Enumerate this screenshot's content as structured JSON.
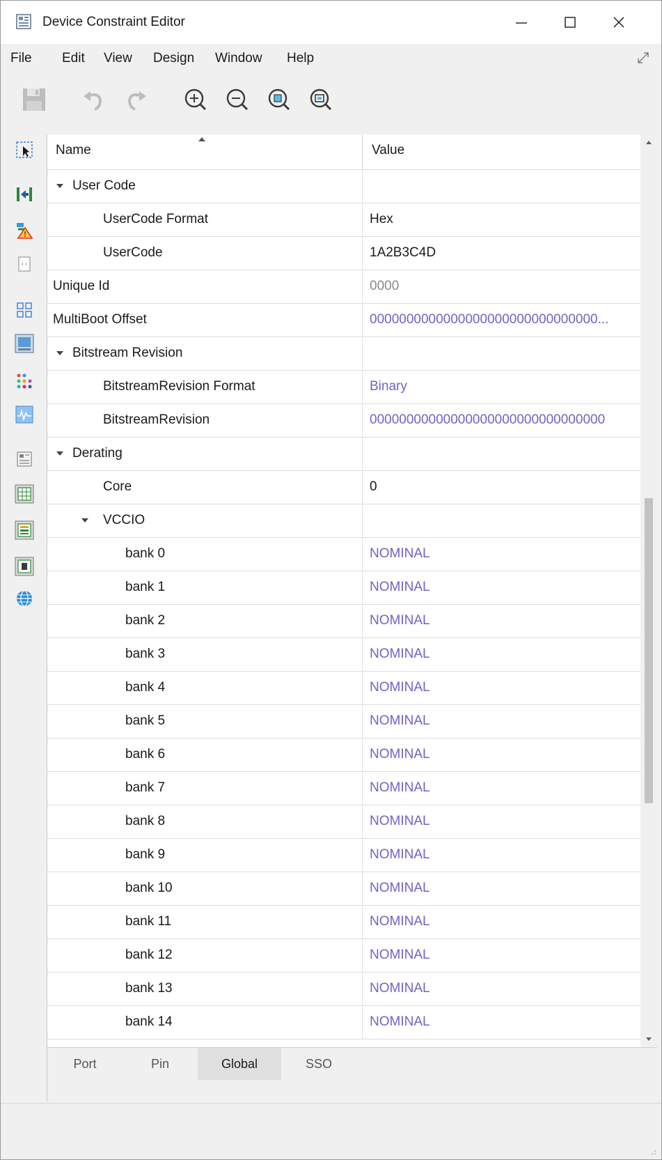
{
  "window": {
    "title": "Device Constraint Editor",
    "minimize_label": "minimize",
    "maximize_label": "maximize",
    "close_label": "close"
  },
  "menu": [
    {
      "label": "File"
    },
    {
      "label": "Edit"
    },
    {
      "label": "View"
    },
    {
      "label": "Design"
    },
    {
      "label": "Window"
    },
    {
      "label": "Help"
    }
  ],
  "toolbar": {
    "icons": [
      "save-icon",
      "undo-icon",
      "redo-icon",
      "zoom-in-icon",
      "zoom-out-icon",
      "zoom-fit-icon",
      "zoom-selection-icon"
    ]
  },
  "sidebar": {
    "icons": [
      "select-icon",
      "assign-icon",
      "drc-warning-icon",
      "pin-view-icon",
      "layout-grid-icon",
      "chip-view-icon",
      "color-dots-icon",
      "waveform-icon",
      "package-icon",
      "spreadsheet-icon",
      "list-view-icon",
      "device-icon",
      "globe-icon"
    ]
  },
  "grid": {
    "columns": {
      "name": "Name",
      "value": "Value"
    },
    "rows": [
      {
        "name": "User Code",
        "value": "",
        "level": 0,
        "expandable": true,
        "style": "dark"
      },
      {
        "name": "UserCode Format",
        "value": "Hex",
        "level": 1,
        "expandable": false,
        "style": "dark"
      },
      {
        "name": "UserCode",
        "value": "1A2B3C4D",
        "level": 1,
        "expandable": false,
        "style": "dark"
      },
      {
        "name": "Unique Id",
        "value": "0000",
        "level": -1,
        "expandable": false,
        "style": "gray"
      },
      {
        "name": "MultiBoot Offset",
        "value": "0000000000000000000000000000000...",
        "level": -1,
        "expandable": false,
        "style": "blue"
      },
      {
        "name": "Bitstream Revision",
        "value": "",
        "level": 0,
        "expandable": true,
        "style": "dark"
      },
      {
        "name": "BitstreamRevision Format",
        "value": "Binary",
        "level": 1,
        "expandable": false,
        "style": "blue"
      },
      {
        "name": "BitstreamRevision",
        "value": "00000000000000000000000000000000",
        "level": 1,
        "expandable": false,
        "style": "blue"
      },
      {
        "name": "Derating",
        "value": "",
        "level": 0,
        "expandable": true,
        "style": "dark"
      },
      {
        "name": "Core",
        "value": "0",
        "level": 1,
        "expandable": false,
        "style": "dark"
      },
      {
        "name": "VCCIO",
        "value": "",
        "level": 1,
        "expandable": true,
        "style": "dark"
      },
      {
        "name": "bank 0",
        "value": "NOMINAL",
        "level": 2,
        "expandable": false,
        "style": "blue"
      },
      {
        "name": "bank 1",
        "value": "NOMINAL",
        "level": 2,
        "expandable": false,
        "style": "blue"
      },
      {
        "name": "bank 2",
        "value": "NOMINAL",
        "level": 2,
        "expandable": false,
        "style": "blue"
      },
      {
        "name": "bank 3",
        "value": "NOMINAL",
        "level": 2,
        "expandable": false,
        "style": "blue"
      },
      {
        "name": "bank 4",
        "value": "NOMINAL",
        "level": 2,
        "expandable": false,
        "style": "blue"
      },
      {
        "name": "bank 5",
        "value": "NOMINAL",
        "level": 2,
        "expandable": false,
        "style": "blue"
      },
      {
        "name": "bank 6",
        "value": "NOMINAL",
        "level": 2,
        "expandable": false,
        "style": "blue"
      },
      {
        "name": "bank 7",
        "value": "NOMINAL",
        "level": 2,
        "expandable": false,
        "style": "blue"
      },
      {
        "name": "bank 8",
        "value": "NOMINAL",
        "level": 2,
        "expandable": false,
        "style": "blue"
      },
      {
        "name": "bank 9",
        "value": "NOMINAL",
        "level": 2,
        "expandable": false,
        "style": "blue"
      },
      {
        "name": "bank 10",
        "value": "NOMINAL",
        "level": 2,
        "expandable": false,
        "style": "blue"
      },
      {
        "name": "bank 11",
        "value": "NOMINAL",
        "level": 2,
        "expandable": false,
        "style": "blue"
      },
      {
        "name": "bank 12",
        "value": "NOMINAL",
        "level": 2,
        "expandable": false,
        "style": "blue"
      },
      {
        "name": "bank 13",
        "value": "NOMINAL",
        "level": 2,
        "expandable": false,
        "style": "blue"
      },
      {
        "name": "bank 14",
        "value": "NOMINAL",
        "level": 2,
        "expandable": false,
        "style": "blue"
      }
    ]
  },
  "tabs": [
    {
      "label": "Port",
      "active": false
    },
    {
      "label": "Pin",
      "active": false
    },
    {
      "label": "Global",
      "active": true
    },
    {
      "label": "SSO",
      "active": false
    }
  ],
  "colors": {
    "value_blue": "#6f64c4",
    "value_gray": "#8a8a8a",
    "text_dark": "#1a1a1a"
  }
}
